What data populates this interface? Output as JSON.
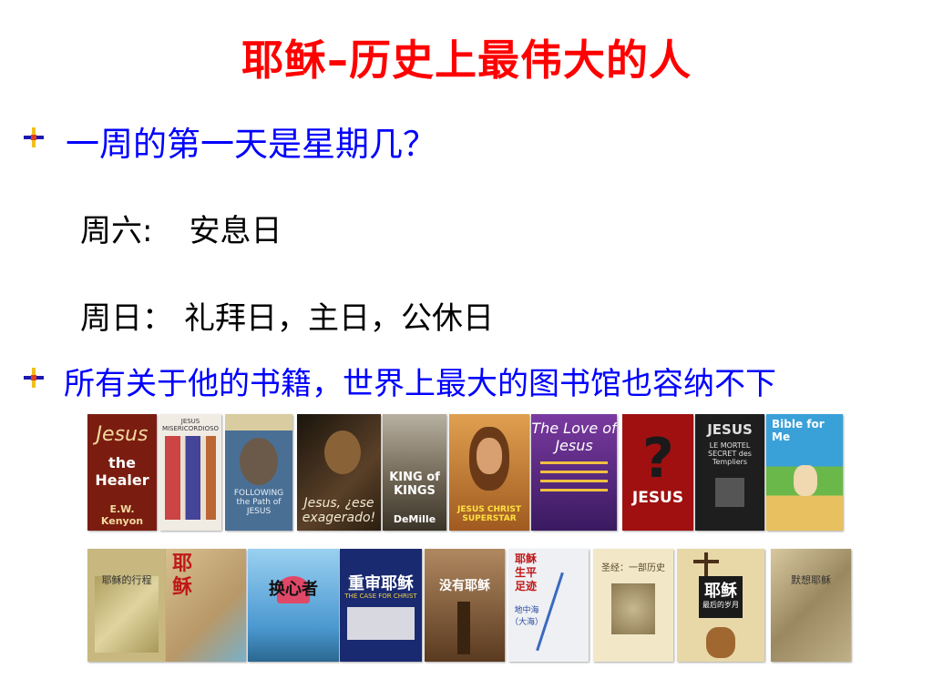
{
  "slide": {
    "title": "耶稣–历史上最伟大的人",
    "question1": "一周的第一天是星期几？",
    "saturday_label": "周六:",
    "saturday_value": "安息日",
    "sunday_label": "周日：",
    "sunday_value": "礼拜日，主日，公休日",
    "question2": "所有关于他的书籍，世界上最大的图书馆也容纳不下"
  },
  "books_row1": [
    {
      "title_a": "Jesus",
      "title_b": "the Healer",
      "author": "E.W. Kenyon",
      "color": "#7a1d10"
    },
    {
      "title_a": "JESUS MISERICORDIOSO",
      "color": "#f0ece4"
    },
    {
      "title_a": "FOLLOWING the Path of JESUS",
      "color": "#4a6f95"
    },
    {
      "title_a": "Jesus, ¿ese exagerado!",
      "color": "#3a2a18"
    },
    {
      "title_a": "KING of KINGS",
      "title_b": "DeMille",
      "color": "#8a8070"
    },
    {
      "title_a": "JESUS CHRIST SUPERSTAR",
      "color": "#c07a30"
    },
    {
      "title_a": "The Love of Jesus",
      "color": "#5a2a80"
    },
    {
      "title_a": "JESUS",
      "color": "#b01818"
    },
    {
      "title_a": "JESUS",
      "title_b": "LE MORTEL SECRET des Templiers",
      "color": "#222222"
    },
    {
      "title_a": "Bible for Me",
      "color": "#3aa0d8"
    }
  ],
  "books_row2": [
    {
      "title_a": "耶稣的行程",
      "color": "#c8b880"
    },
    {
      "title_a": "耶稣",
      "color": "#d8c090"
    },
    {
      "title_a": "换心者",
      "color": "#70b8e0"
    },
    {
      "title_a": "重审耶稣",
      "title_b": "THE CASE FOR CHRIST",
      "color": "#1a2a70"
    },
    {
      "title_a": "没有耶稣",
      "color": "#9a7048"
    },
    {
      "title_a": "耶稣生平足迹",
      "title_b": "地中海（大海）",
      "color": "#eef0f4"
    },
    {
      "title_a": "圣经：一部历史",
      "color": "#f2e8c8"
    },
    {
      "title_a": "耶稣",
      "title_b": "最后的岁月",
      "color": "#e8d8a8"
    },
    {
      "title_a": "默想耶稣",
      "color": "#c0b088"
    },
    {
      "title_a": "",
      "color": "#ffffff"
    }
  ]
}
